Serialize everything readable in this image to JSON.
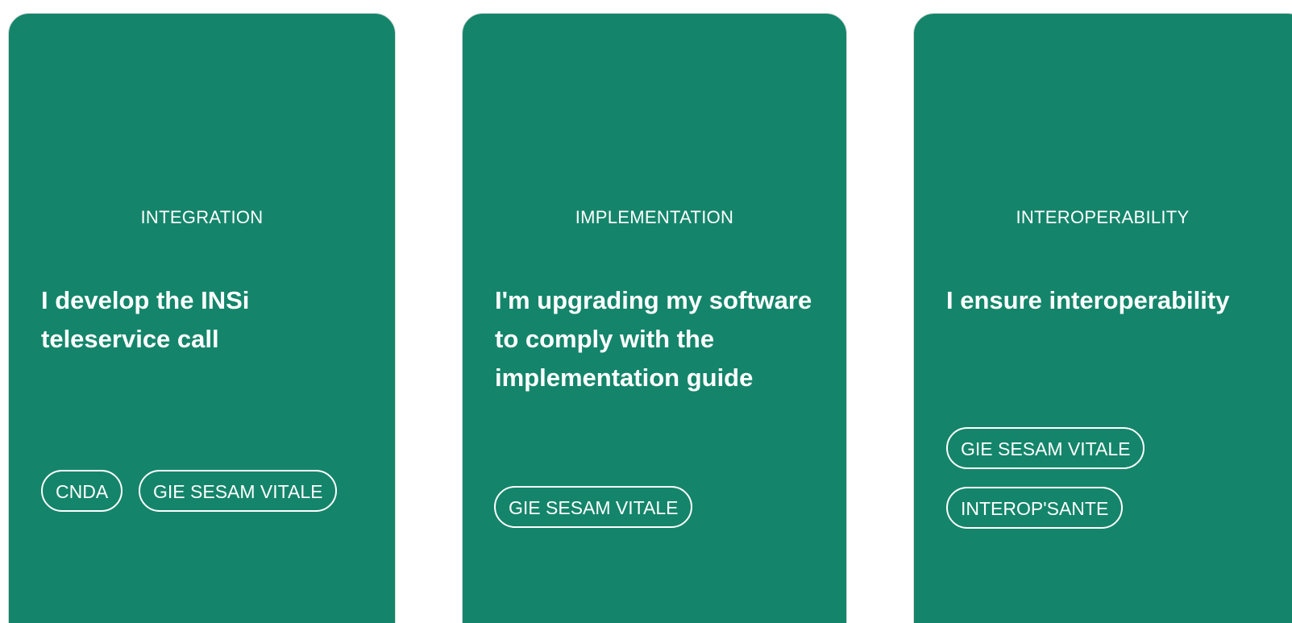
{
  "cards": [
    {
      "category": "INTEGRATION",
      "headline": "I develop the INSi teleservice call",
      "tags": [
        "CNDA",
        "GIE SESAM VITALE"
      ]
    },
    {
      "category": "IMPLEMENTATION",
      "headline": "I'm upgrading my software to comply with the implementation guide",
      "tags": [
        "GIE SESAM VITALE"
      ]
    },
    {
      "category": "INTEROPERABILITY",
      "headline": "I ensure interoperability",
      "tags": [
        "GIE SESAM VITALE",
        "INTEROP'SANTE"
      ]
    }
  ],
  "colors": {
    "card_background": "#14856a",
    "card_text": "#ffffff",
    "page_background": "#ffffff"
  }
}
